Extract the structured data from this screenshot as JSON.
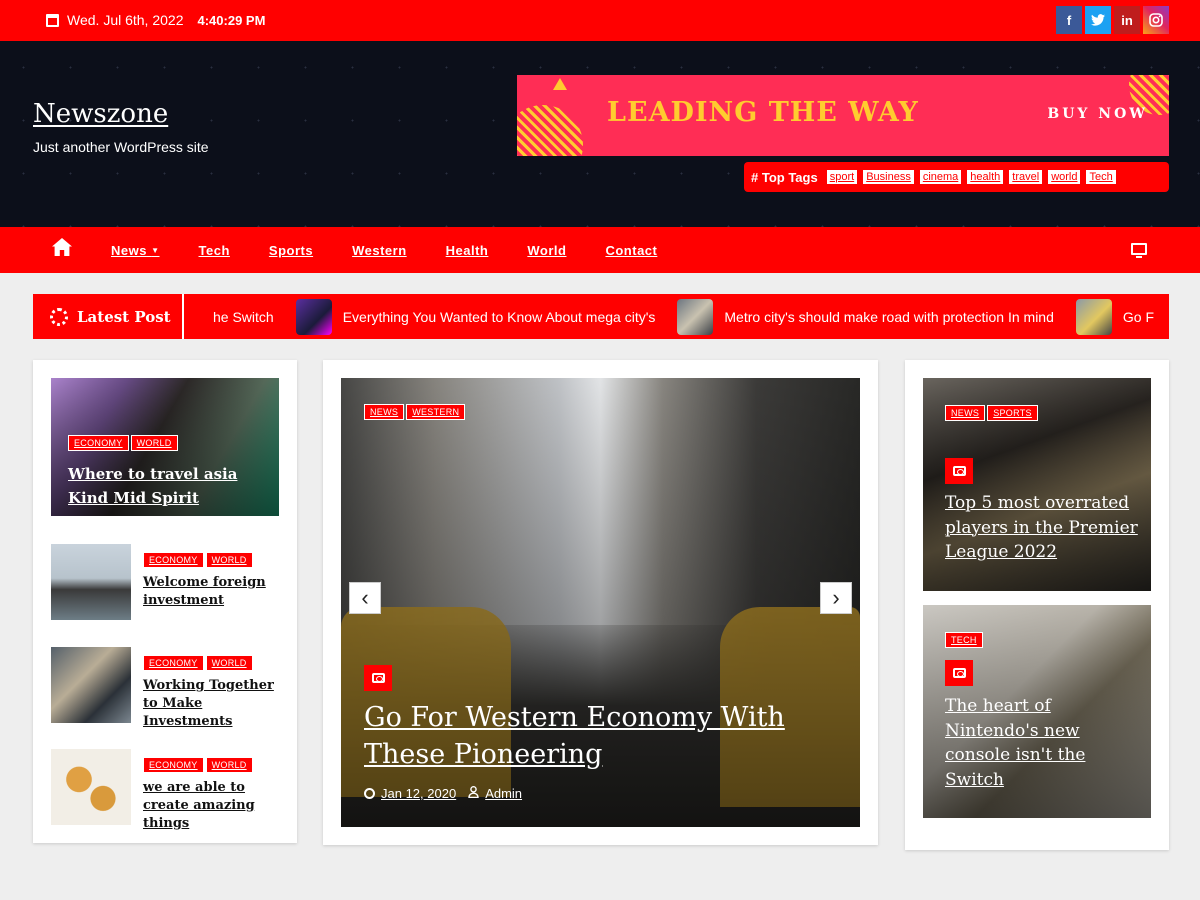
{
  "topbar": {
    "date": "Wed. Jul 6th, 2022",
    "time": "4:40:29 PM",
    "social": [
      {
        "icon": "facebook-icon",
        "glyph": "f"
      },
      {
        "icon": "twitter-icon",
        "glyph": "t"
      },
      {
        "icon": "linkedin-icon",
        "glyph": "in"
      },
      {
        "icon": "instagram-icon",
        "glyph": "◎"
      }
    ]
  },
  "header": {
    "site_title": "Newszone",
    "tagline": "Just another WordPress site",
    "banner": {
      "headline": "LEADING THE WAY",
      "cta": "BUY NOW"
    },
    "top_tags": {
      "label": "Top Tags",
      "tags": [
        "sport",
        "Business",
        "cinema",
        "health",
        "travel",
        "world",
        "Tech"
      ]
    }
  },
  "nav": {
    "items": [
      "News",
      "Tech",
      "Sports",
      "Western",
      "Health",
      "World",
      "Contact"
    ]
  },
  "ticker": {
    "label": "Latest Post",
    "items": [
      "he Switch",
      "Everything You Wanted to Know About mega city's",
      "Metro city's should make road with protection In mind",
      "Go F"
    ]
  },
  "left_column": {
    "featured": {
      "categories": [
        "ECONOMY",
        "WORLD"
      ],
      "title": "Where to travel asia Kind Mid Spirit"
    },
    "list": [
      {
        "categories": [
          "ECONOMY",
          "WORLD"
        ],
        "title": "Welcome foreign investment"
      },
      {
        "categories": [
          "ECONOMY",
          "WORLD"
        ],
        "title": "Working Together to Make Investments"
      },
      {
        "categories": [
          "ECONOMY",
          "WORLD"
        ],
        "title": "we are able to create amazing things"
      }
    ]
  },
  "slider": {
    "categories": [
      "NEWS",
      "WESTERN"
    ],
    "title": "Go For Western Economy With These Pioneering",
    "date": "Jan 12, 2020",
    "author": "Admin"
  },
  "right_column": [
    {
      "categories": [
        "NEWS",
        "SPORTS"
      ],
      "title": "Top 5 most overrated players in the Premier League 2022"
    },
    {
      "categories": [
        "TECH"
      ],
      "title": "The heart of Nintendo's new console isn't the Switch"
    }
  ],
  "colors": {
    "accent": "#ff0000",
    "header_bg": "#0c0f1a",
    "banner": "#ff2d55",
    "banner_text": "#ffcc2f"
  }
}
